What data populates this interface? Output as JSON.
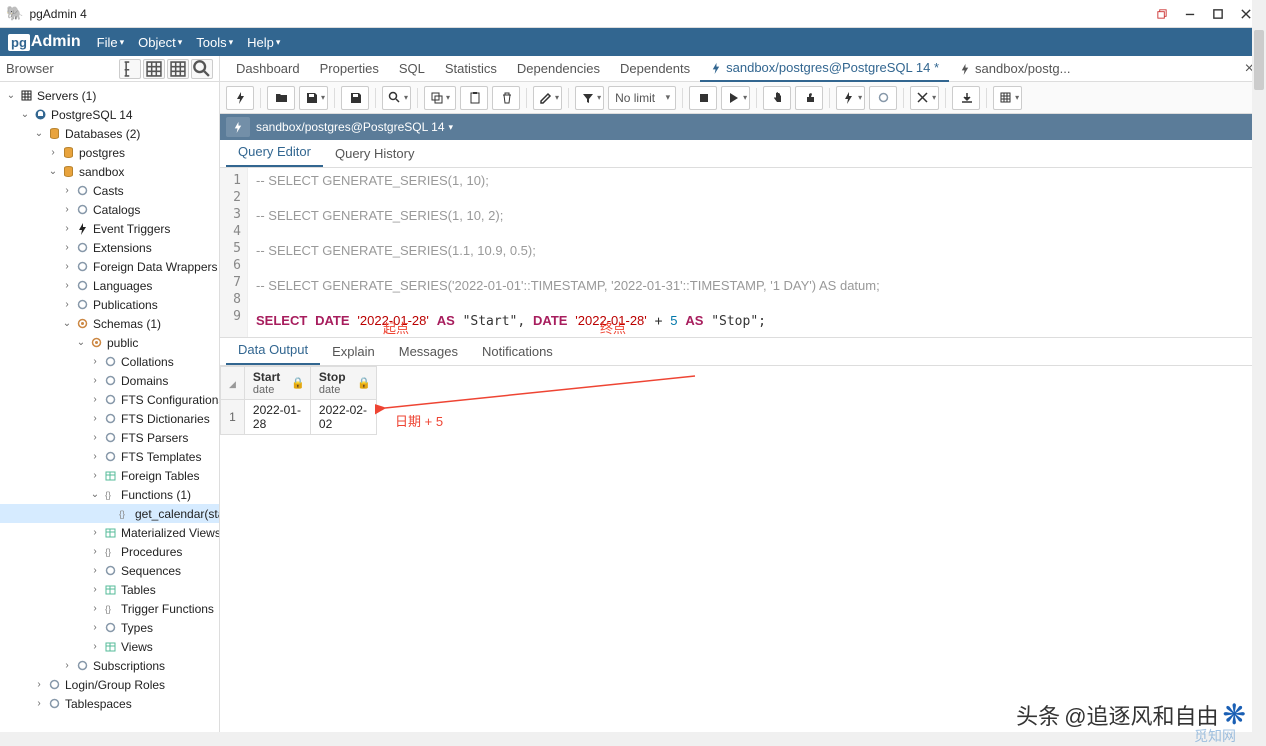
{
  "window": {
    "title": "pgAdmin 4"
  },
  "menubar": {
    "brand": "Admin",
    "items": [
      "File",
      "Object",
      "Tools",
      "Help"
    ]
  },
  "browser": {
    "title": "Browser",
    "tree": [
      {
        "lvl": 0,
        "tw": "v",
        "ic": "server-group",
        "txt": "Servers (1)"
      },
      {
        "lvl": 1,
        "tw": "v",
        "ic": "elephant",
        "txt": "PostgreSQL 14"
      },
      {
        "lvl": 2,
        "tw": "v",
        "ic": "db-group",
        "txt": "Databases (2)"
      },
      {
        "lvl": 3,
        "tw": ">",
        "ic": "db",
        "txt": "postgres"
      },
      {
        "lvl": 3,
        "tw": "v",
        "ic": "db",
        "txt": "sandbox"
      },
      {
        "lvl": 4,
        "tw": ">",
        "ic": "casts",
        "txt": "Casts"
      },
      {
        "lvl": 4,
        "tw": ">",
        "ic": "catalog",
        "txt": "Catalogs"
      },
      {
        "lvl": 4,
        "tw": ">",
        "ic": "trigger",
        "txt": "Event Triggers"
      },
      {
        "lvl": 4,
        "tw": ">",
        "ic": "ext",
        "txt": "Extensions"
      },
      {
        "lvl": 4,
        "tw": ">",
        "ic": "fdw",
        "txt": "Foreign Data Wrappers"
      },
      {
        "lvl": 4,
        "tw": ">",
        "ic": "lang",
        "txt": "Languages"
      },
      {
        "lvl": 4,
        "tw": ">",
        "ic": "pub",
        "txt": "Publications"
      },
      {
        "lvl": 4,
        "tw": "v",
        "ic": "schema",
        "txt": "Schemas (1)"
      },
      {
        "lvl": 5,
        "tw": "v",
        "ic": "schema",
        "txt": "public"
      },
      {
        "lvl": 6,
        "tw": ">",
        "ic": "coll",
        "txt": "Collations"
      },
      {
        "lvl": 6,
        "tw": ">",
        "ic": "dom",
        "txt": "Domains"
      },
      {
        "lvl": 6,
        "tw": ">",
        "ic": "fts",
        "txt": "FTS Configurations"
      },
      {
        "lvl": 6,
        "tw": ">",
        "ic": "fts",
        "txt": "FTS Dictionaries"
      },
      {
        "lvl": 6,
        "tw": ">",
        "ic": "ftsp",
        "txt": "FTS Parsers"
      },
      {
        "lvl": 6,
        "tw": ">",
        "ic": "fts",
        "txt": "FTS Templates"
      },
      {
        "lvl": 6,
        "tw": ">",
        "ic": "ftable",
        "txt": "Foreign Tables"
      },
      {
        "lvl": 6,
        "tw": "v",
        "ic": "func",
        "txt": "Functions (1)",
        "sel": false
      },
      {
        "lvl": 7,
        "tw": "",
        "ic": "func",
        "txt": "get_calendar(start_",
        "sel": true
      },
      {
        "lvl": 6,
        "tw": ">",
        "ic": "mview",
        "txt": "Materialized Views"
      },
      {
        "lvl": 6,
        "tw": ">",
        "ic": "proc",
        "txt": "Procedures"
      },
      {
        "lvl": 6,
        "tw": ">",
        "ic": "seq",
        "txt": "Sequences"
      },
      {
        "lvl": 6,
        "tw": ">",
        "ic": "table",
        "txt": "Tables"
      },
      {
        "lvl": 6,
        "tw": ">",
        "ic": "tfunc",
        "txt": "Trigger Functions"
      },
      {
        "lvl": 6,
        "tw": ">",
        "ic": "type",
        "txt": "Types"
      },
      {
        "lvl": 6,
        "tw": ">",
        "ic": "view",
        "txt": "Views"
      },
      {
        "lvl": 4,
        "tw": ">",
        "ic": "sub",
        "txt": "Subscriptions"
      },
      {
        "lvl": 2,
        "tw": ">",
        "ic": "roles",
        "txt": "Login/Group Roles"
      },
      {
        "lvl": 2,
        "tw": ">",
        "ic": "tblspc",
        "txt": "Tablespaces"
      }
    ]
  },
  "tabs": {
    "items": [
      {
        "label": "Dashboard"
      },
      {
        "label": "Properties"
      },
      {
        "label": "SQL"
      },
      {
        "label": "Statistics"
      },
      {
        "label": "Dependencies"
      },
      {
        "label": "Dependents"
      },
      {
        "label": "sandbox/postgres@PostgreSQL 14 *",
        "icon": "query",
        "active": true
      },
      {
        "label": "sandbox/postg...",
        "icon": "query"
      }
    ]
  },
  "toolbar": {
    "nolimit": "No limit"
  },
  "connbar": {
    "text": "sandbox/postgres@PostgreSQL 14"
  },
  "subtabs": {
    "editor": "Query Editor",
    "history": "Query History"
  },
  "editor": {
    "lines": [
      {
        "n": 1,
        "html": "<span class='cm'>-- SELECT GENERATE_SERIES(1, 10);</span>"
      },
      {
        "n": 2,
        "html": ""
      },
      {
        "n": 3,
        "html": "<span class='cm'>-- SELECT GENERATE_SERIES(1, 10, 2);</span>"
      },
      {
        "n": 4,
        "html": ""
      },
      {
        "n": 5,
        "html": "<span class='cm'>-- SELECT GENERATE_SERIES(1.1, 10.9, 0.5);</span>"
      },
      {
        "n": 6,
        "html": ""
      },
      {
        "n": 7,
        "html": "<span class='cm'>-- SELECT GENERATE_SERIES('2022-01-01'::TIMESTAMP, '2022-01-31'::TIMESTAMP, '1 DAY') AS datum;</span>"
      },
      {
        "n": 8,
        "html": ""
      },
      {
        "n": 9,
        "html": "<span class='kw'>SELECT</span> <span class='kw'>DATE</span> <span class='str'>'2022-01-28'</span> <span class='kw'>AS</span> \"Start\", <span class='kw'>DATE</span> <span class='str'>'2022-01-28'</span> + <span class='num'>5</span> <span class='kw'>AS</span> \"Stop\";"
      }
    ]
  },
  "annotations": {
    "start": "起点",
    "end": "终点",
    "date5": "日期 + 5"
  },
  "outtabs": {
    "data": "Data Output",
    "explain": "Explain",
    "messages": "Messages",
    "notif": "Notifications"
  },
  "results": {
    "cols": [
      {
        "name": "Start",
        "type": "date"
      },
      {
        "name": "Stop",
        "type": "date"
      }
    ],
    "rows": [
      {
        "n": 1,
        "cells": [
          "2022-01-28",
          "2022-02-02"
        ]
      }
    ]
  },
  "watermark": {
    "line1_a": "头条",
    "line1_b": "@追逐风和自由",
    "line2": "觅知网"
  }
}
